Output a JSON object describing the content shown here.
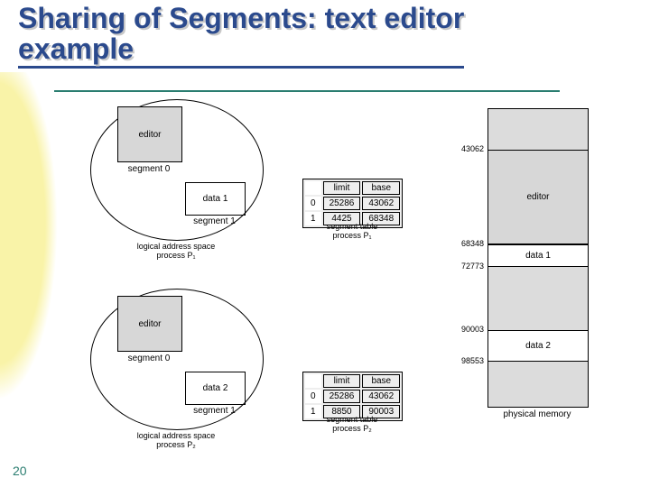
{
  "title_line1": "Sharing of Segments: text editor",
  "title_line2": "example",
  "page_number": "20",
  "process1": {
    "seg0_label": "editor",
    "seg0_caption": "segment 0",
    "seg1_label": "data 1",
    "seg1_caption": "segment 1",
    "space_caption_l1": "logical address space",
    "space_caption_l2": "process P₁",
    "table_caption_l1": "segment table",
    "table_caption_l2": "process P₁",
    "table": {
      "headers": [
        "limit",
        "base"
      ],
      "rows": [
        {
          "idx": "0",
          "limit": "25286",
          "base": "43062"
        },
        {
          "idx": "1",
          "limit": "4425",
          "base": "68348"
        }
      ]
    }
  },
  "process2": {
    "seg0_label": "editor",
    "seg0_caption": "segment 0",
    "seg1_label": "data 2",
    "seg1_caption": "segment 1",
    "space_caption_l1": "logical address space",
    "space_caption_l2": "process P₂",
    "table_caption_l1": "segment table",
    "table_caption_l2": "process P₂",
    "table": {
      "headers": [
        "limit",
        "base"
      ],
      "rows": [
        {
          "idx": "0",
          "limit": "25286",
          "base": "43062"
        },
        {
          "idx": "1",
          "limit": "8850",
          "base": "90003"
        }
      ]
    }
  },
  "memory": {
    "caption": "physical memory",
    "labels": {
      "editor": "editor",
      "data1": "data 1",
      "data2": "data 2"
    },
    "addresses": [
      "43062",
      "68348",
      "72773",
      "90003",
      "98553"
    ]
  },
  "chart_data": {
    "type": "table",
    "title": "Sharing of Segments: text editor example",
    "processes": [
      {
        "name": "P1",
        "segments": [
          {
            "segment": 0,
            "content": "editor",
            "limit": 25286,
            "base": 43062
          },
          {
            "segment": 1,
            "content": "data 1",
            "limit": 4425,
            "base": 68348
          }
        ]
      },
      {
        "name": "P2",
        "segments": [
          {
            "segment": 0,
            "content": "editor",
            "limit": 25286,
            "base": 43062
          },
          {
            "segment": 1,
            "content": "data 2",
            "limit": 8850,
            "base": 90003
          }
        ]
      }
    ],
    "physical_memory": [
      {
        "start": 43062,
        "end": 68348,
        "content": "editor"
      },
      {
        "start": 68348,
        "end": 72773,
        "content": "data 1"
      },
      {
        "start": 90003,
        "end": 98553,
        "content": "data 2"
      }
    ]
  }
}
